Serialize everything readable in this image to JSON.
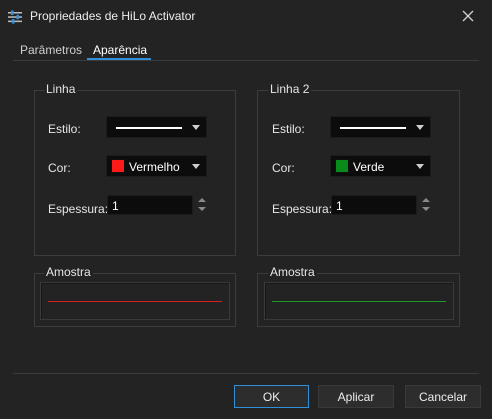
{
  "window": {
    "title": "Propriedades de HiLo Activator",
    "app_icon": "sliders-icon",
    "close_icon": "close-icon"
  },
  "tabs": [
    {
      "label": "Parâmetros",
      "active": false
    },
    {
      "label": "Aparência",
      "active": true
    }
  ],
  "lines": [
    {
      "group_label": "Linha",
      "style_label": "Estilo:",
      "style_value": "solid",
      "color_label": "Cor:",
      "color_name": "Vermelho",
      "color_hex": "#ff1a1a",
      "thickness_label": "Espessura:",
      "thickness_value": "1"
    },
    {
      "group_label": "Linha 2",
      "style_label": "Estilo:",
      "style_value": "solid",
      "color_label": "Cor:",
      "color_name": "Verde",
      "color_hex": "#0a8a1a",
      "thickness_label": "Espessura:",
      "thickness_value": "1"
    }
  ],
  "samples": [
    {
      "label": "Amostra",
      "line_color": "#d42020"
    },
    {
      "label": "Amostra",
      "line_color": "#1a9a2a"
    }
  ],
  "buttons": {
    "ok": "OK",
    "apply": "Aplicar",
    "cancel": "Cancelar"
  },
  "colors": {
    "accent": "#2f8fd8",
    "background": "#232323"
  }
}
